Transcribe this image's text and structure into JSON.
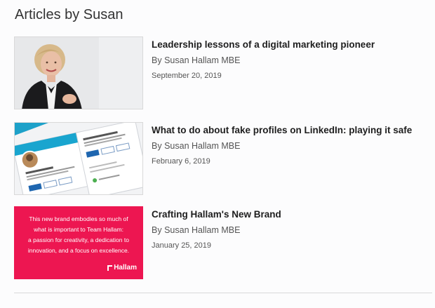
{
  "heading": "Articles by Susan",
  "articles": [
    {
      "title": "Leadership lessons of a digital marketing pioneer",
      "by": "By",
      "author": "Susan Hallam MBE",
      "date": "September 20, 2019"
    },
    {
      "title": "What to do about fake profiles on LinkedIn: playing it safe",
      "by": "By",
      "author": "Susan Hallam MBE",
      "date": "February 6, 2019"
    },
    {
      "title": "Crafting Hallam's New Brand",
      "by": "By",
      "author": "Susan Hallam MBE",
      "date": "January 25, 2019",
      "thumb": {
        "quote_lines": [
          "This new brand embodies so much of",
          "what is important to Team Hallam:",
          "a passion for creativity, a dedication to",
          "innovation, and a focus on excellence."
        ],
        "logo_text": "Hallam",
        "bg_color": "#ed1651"
      }
    }
  ]
}
